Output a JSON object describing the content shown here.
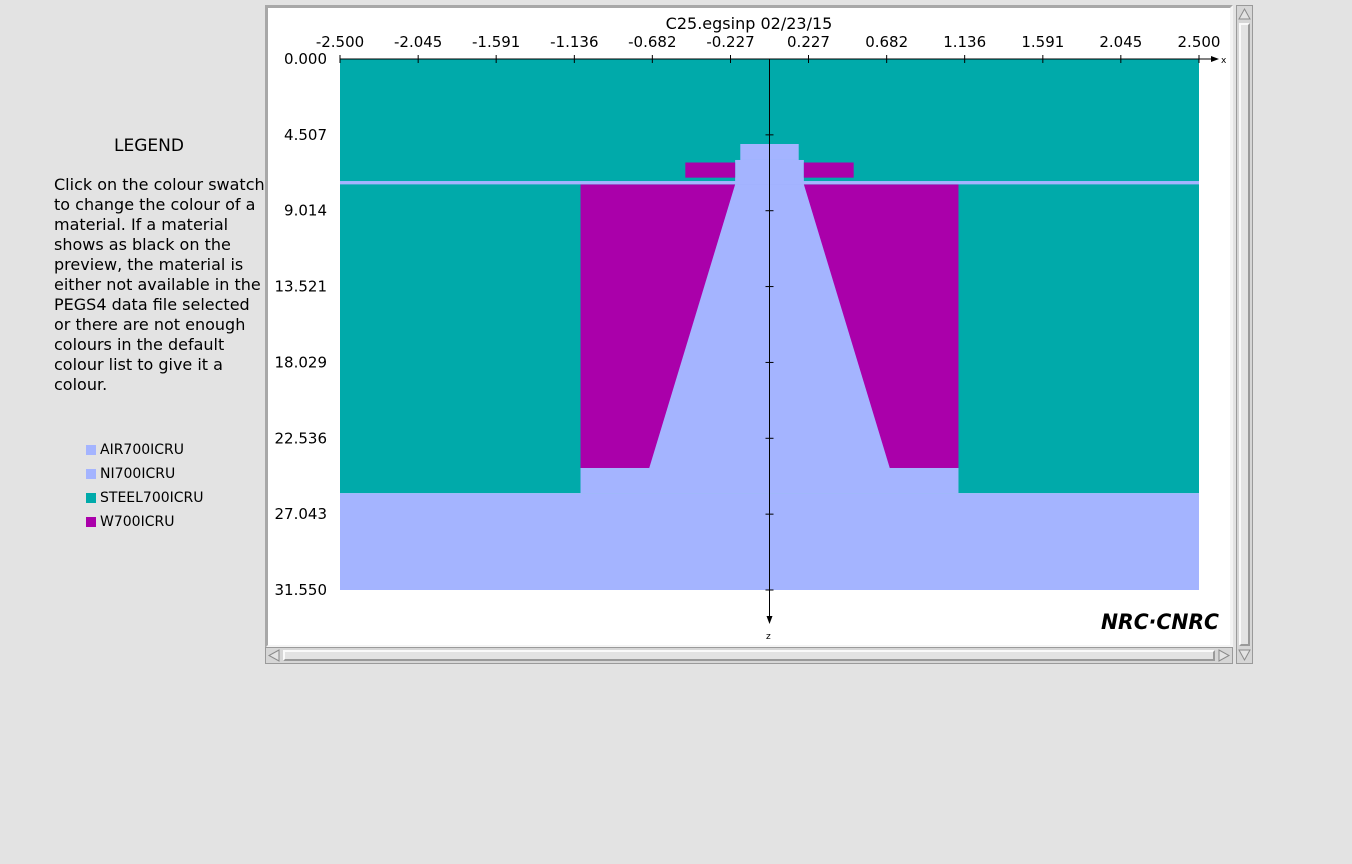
{
  "legend": {
    "title": "LEGEND",
    "help_text": "Click on the colour swatch to change the colour of a material.  If a material shows as black on the preview, the material is either not available in the PEGS4 data file selected or there are not enough colours in the default colour list to give it a colour.",
    "items": [
      {
        "label": "AIR700ICRU",
        "color": "#a4b4ff"
      },
      {
        "label": "NI700ICRU",
        "color": "#a4b4ff"
      },
      {
        "label": "STEEL700ICRU",
        "color": "#00aaaa"
      },
      {
        "label": "W700ICRU",
        "color": "#aa00aa"
      }
    ]
  },
  "preview": {
    "title": "C25.egsinp   02/23/15",
    "x_axis_label": "x",
    "z_axis_label": "z",
    "x_ticks": [
      "-2.500",
      "-2.045",
      "-1.591",
      "-1.136",
      "-0.682",
      "-0.227",
      "0.227",
      "0.682",
      "1.136",
      "1.591",
      "2.045",
      "2.500"
    ],
    "z_ticks": [
      "0.000",
      "4.507",
      "9.014",
      "13.521",
      "18.029",
      "22.536",
      "27.043",
      "31.550"
    ],
    "logo": "NRC·CNRC"
  },
  "chart_data": {
    "type": "geometry",
    "title": "C25.egsinp   02/23/15",
    "xlim": [
      -2.5,
      2.5
    ],
    "zlim": [
      0.0,
      31.55
    ],
    "x_ticks": [
      -2.5,
      -2.045,
      -1.591,
      -1.136,
      -0.682,
      -0.227,
      0.227,
      0.682,
      1.136,
      1.591,
      2.045,
      2.5
    ],
    "z_ticks": [
      0.0,
      4.507,
      9.014,
      13.521,
      18.029,
      22.536,
      27.043,
      31.55
    ],
    "regions": [
      {
        "material": "STEEL700ICRU",
        "shape": "rect",
        "x": [
          -2.5,
          2.5
        ],
        "z": [
          0.0,
          25.8
        ]
      },
      {
        "material": "AIR700ICRU",
        "shape": "rect",
        "x": [
          -2.5,
          2.5
        ],
        "z": [
          25.8,
          31.55
        ]
      },
      {
        "material": "AIR700ICRU",
        "shape": "rect",
        "x": [
          -1.1,
          1.1
        ],
        "z": [
          24.3,
          25.8
        ]
      },
      {
        "material": "W700ICRU",
        "shape": "rect",
        "x": [
          -1.1,
          1.1
        ],
        "z": [
          7.45,
          24.3
        ]
      },
      {
        "material": "AIR700ICRU",
        "shape": "polygon",
        "points": [
          [
            -0.2,
            7.45
          ],
          [
            0.2,
            7.45
          ],
          [
            0.7,
            24.3
          ],
          [
            -0.7,
            24.3
          ]
        ]
      },
      {
        "material": "AIR700ICRU",
        "shape": "rect",
        "x": [
          -0.2,
          0.2
        ],
        "z": [
          6.0,
          7.45
        ]
      },
      {
        "material": "AIR700ICRU",
        "shape": "rect",
        "x": [
          -0.17,
          0.17
        ],
        "z": [
          5.05,
          6.0
        ]
      },
      {
        "material": "W700ICRU",
        "shape": "rect",
        "x": [
          -0.49,
          -0.2
        ],
        "z": [
          6.15,
          7.05
        ]
      },
      {
        "material": "W700ICRU",
        "shape": "rect",
        "x": [
          0.2,
          0.49
        ],
        "z": [
          6.15,
          7.05
        ]
      },
      {
        "material": "AIR700ICRU",
        "shape": "rect",
        "x": [
          -2.5,
          2.5
        ],
        "z": [
          7.25,
          7.45
        ]
      }
    ]
  }
}
